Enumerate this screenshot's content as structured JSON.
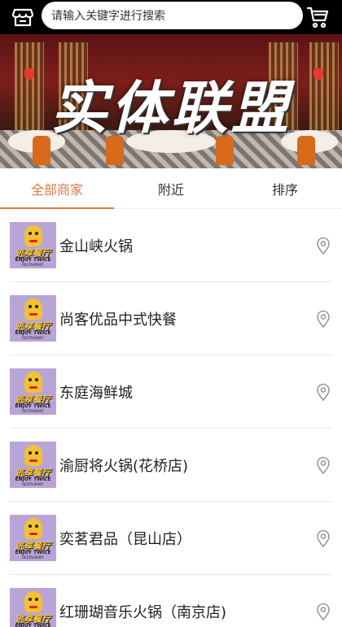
{
  "header": {
    "search_placeholder": "请输入关键字进行搜索",
    "store_icon": "store-icon",
    "cart_icon": "cart-icon"
  },
  "banner": {
    "title": "实体联盟"
  },
  "tabs": [
    {
      "label": "全部商家",
      "active": true
    },
    {
      "label": "附近",
      "active": false
    },
    {
      "label": "排序",
      "active": false
    }
  ],
  "logo": {
    "brand": "逃享餐厅",
    "line1": "ENJOY TWICE",
    "line2": "RESTAURANT"
  },
  "merchants": [
    {
      "name": "金山峡火锅"
    },
    {
      "name": "尚客优品中式快餐"
    },
    {
      "name": "东庭海鲜城"
    },
    {
      "name": "渝厨将火锅(花桥店)"
    },
    {
      "name": "奕茗君品（昆山店）"
    },
    {
      "name": "红珊瑚音乐火锅（南京店)"
    }
  ],
  "colors": {
    "accent": "#e07a46",
    "header_bg": "#000000",
    "logo_bg": "#b9a4d8"
  }
}
